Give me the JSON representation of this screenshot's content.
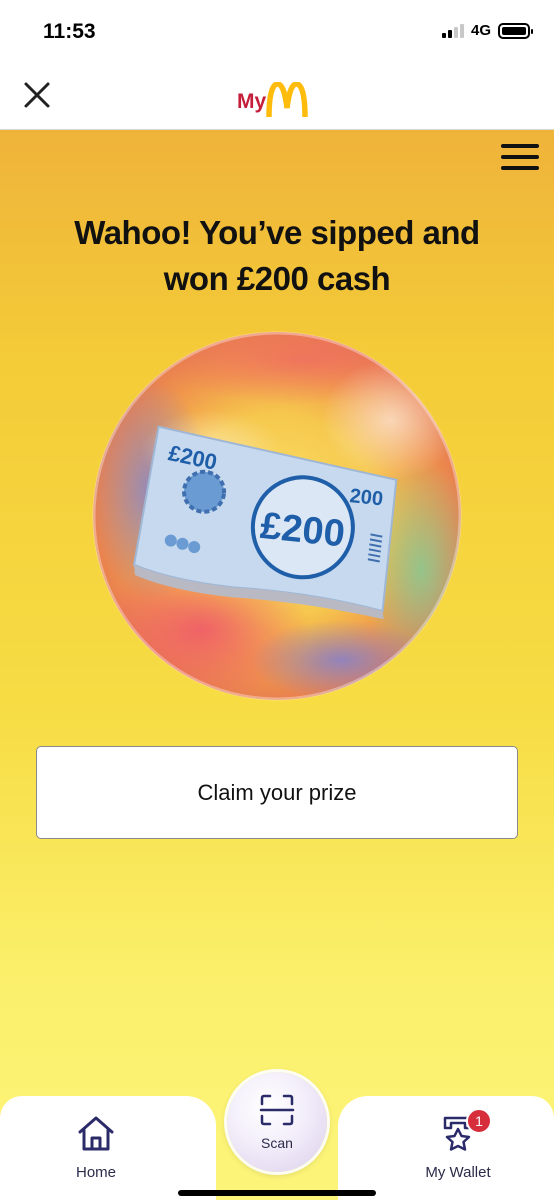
{
  "status_bar": {
    "time": "11:53",
    "network": "4G"
  },
  "header": {
    "logo_text": "My"
  },
  "main": {
    "title_line1": "Wahoo! You’ve sipped and",
    "title_line2": "won £200 cash",
    "banknote": {
      "corner_amount": "£200",
      "right_amount": "200",
      "center_amount": "£200"
    },
    "claim_button_label": "Claim your prize"
  },
  "tabbar": {
    "home_label": "Home",
    "scan_label": "Scan",
    "wallet_label": "My Wallet",
    "wallet_badge": "1"
  },
  "colors": {
    "brand_yellow": "#ffbc0d",
    "brand_red": "#c41e3a",
    "badge_red": "#d62f3b"
  }
}
